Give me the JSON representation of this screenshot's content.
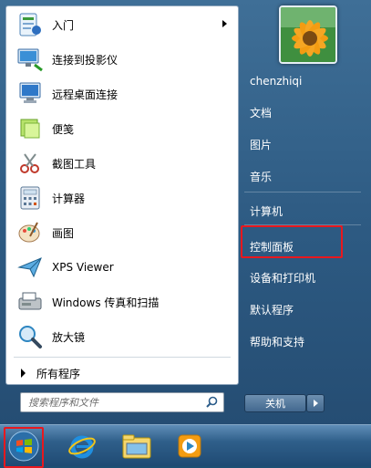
{
  "left_pane": {
    "items": [
      {
        "label": "入门",
        "icon": "getting-started-icon",
        "has_submenu": true
      },
      {
        "label": "连接到投影仪",
        "icon": "projector-icon",
        "has_submenu": false
      },
      {
        "label": "远程桌面连接",
        "icon": "remote-desktop-icon",
        "has_submenu": false
      },
      {
        "label": "便笺",
        "icon": "sticky-notes-icon",
        "has_submenu": false
      },
      {
        "label": "截图工具",
        "icon": "snipping-tool-icon",
        "has_submenu": false
      },
      {
        "label": "计算器",
        "icon": "calculator-icon",
        "has_submenu": false
      },
      {
        "label": "画图",
        "icon": "paint-icon",
        "has_submenu": false
      },
      {
        "label": "XPS Viewer",
        "icon": "xps-viewer-icon",
        "has_submenu": false
      },
      {
        "label": "Windows 传真和扫描",
        "icon": "fax-scan-icon",
        "has_submenu": false
      },
      {
        "label": "放大镜",
        "icon": "magnifier-icon",
        "has_submenu": false
      }
    ],
    "all_programs_label": "所有程序"
  },
  "search": {
    "placeholder": "搜索程序和文件"
  },
  "right_pane": {
    "user_name": "chenzhiqi",
    "items": [
      {
        "label": "文档"
      },
      {
        "label": "图片"
      },
      {
        "label": "音乐"
      },
      {
        "label": "计算机"
      },
      {
        "label": "控制面板",
        "highlighted": true
      },
      {
        "label": "设备和打印机"
      },
      {
        "label": "默认程序"
      },
      {
        "label": "帮助和支持"
      }
    ]
  },
  "shutdown": {
    "label": "关机"
  },
  "taskbar": {
    "items": [
      "start-orb-icon",
      "internet-explorer-icon",
      "windows-explorer-icon",
      "media-player-icon"
    ]
  },
  "colors": {
    "highlight": "#e8181e",
    "menu_blue": "#2d5a82"
  }
}
